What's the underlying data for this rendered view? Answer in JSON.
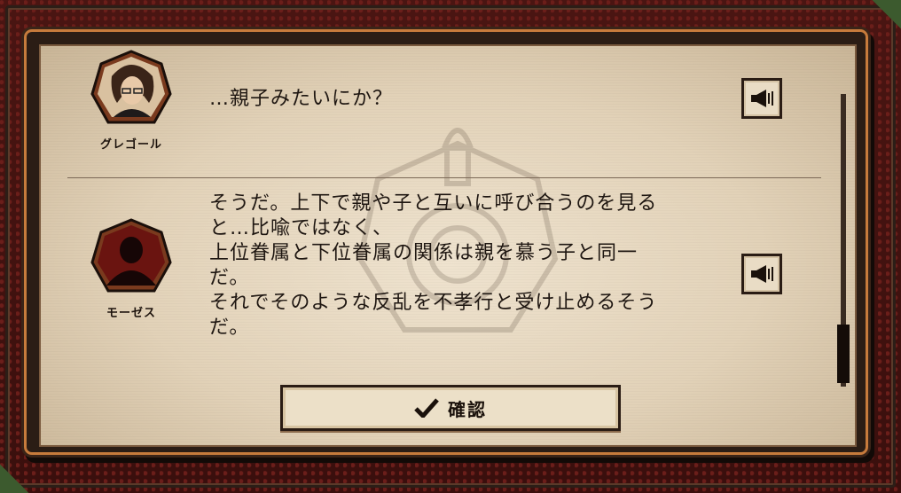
{
  "dialog": {
    "messages": [
      {
        "speaker": "グレゴール",
        "text": "…親子みたいにか？",
        "avatar_icon": "character-portrait-icon",
        "voice_icon": "speaker-icon"
      },
      {
        "speaker": "モーゼス",
        "text_lines": [
          "そうだ。上下で親や子と互いに呼び合うのを見る",
          "と…比喩ではなく、",
          "上位眷属と下位眷属の関係は親を慕う子と同一",
          "だ。",
          "それでそのような反乱を不孝行と受け止めるそう",
          "だ。"
        ],
        "avatar_icon": "silhouette-icon",
        "voice_icon": "speaker-icon"
      }
    ],
    "confirm_label": "確認",
    "confirm_icon": "checkmark-icon"
  },
  "colors": {
    "frame_red": "#4a1512",
    "frame_orange": "#c77b3c",
    "paper": "#e2d2b8",
    "avatar_border": "#7a3a1e"
  }
}
